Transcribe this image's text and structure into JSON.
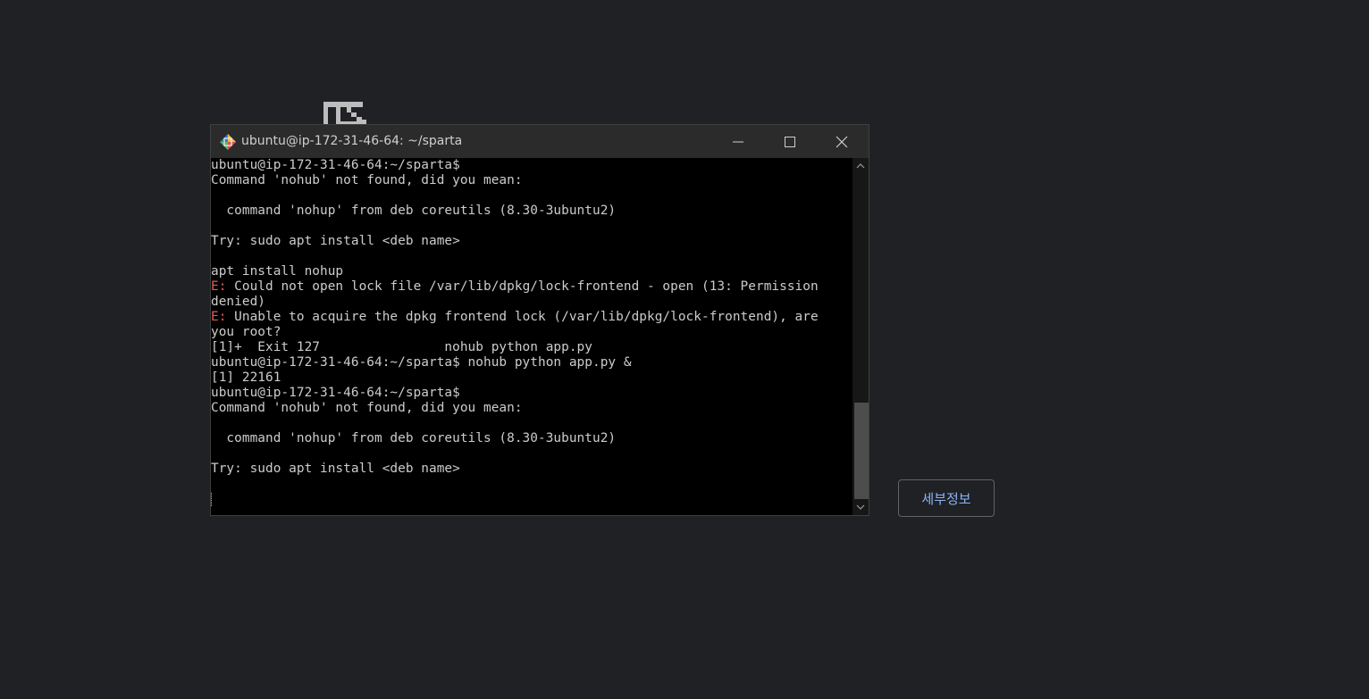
{
  "window": {
    "title": "ubuntu@ip-172-31-46-64: ~/sparta",
    "icon": "putty-icon"
  },
  "terminal": {
    "lines": [
      {
        "text": "ubuntu@ip-172-31-46-64:~/sparta$"
      },
      {
        "text": "Command 'nohub' not found, did you mean:"
      },
      {
        "text": ""
      },
      {
        "text": "  command 'nohup' from deb coreutils (8.30-3ubuntu2)"
      },
      {
        "text": ""
      },
      {
        "text": "Try: sudo apt install <deb name>"
      },
      {
        "text": ""
      },
      {
        "text": "apt install nohup"
      },
      {
        "prefix": "E: ",
        "text": "Could not open lock file /var/lib/dpkg/lock-frontend - open (13: Permission"
      },
      {
        "text": "denied)"
      },
      {
        "prefix": "E: ",
        "text": "Unable to acquire the dpkg frontend lock (/var/lib/dpkg/lock-frontend), are"
      },
      {
        "text": "you root?"
      },
      {
        "text": "[1]+  Exit 127                nohub python app.py"
      },
      {
        "text": "ubuntu@ip-172-31-46-64:~/sparta$ nohub python app.py &"
      },
      {
        "text": "[1] 22161"
      },
      {
        "text": "ubuntu@ip-172-31-46-64:~/sparta$"
      },
      {
        "text": "Command 'nohub' not found, did you mean:"
      },
      {
        "text": ""
      },
      {
        "text": "  command 'nohup' from deb coreutils (8.30-3ubuntu2)"
      },
      {
        "text": ""
      },
      {
        "text": "Try: sudo apt install <deb name>"
      },
      {
        "text": ""
      },
      {
        "text": ""
      }
    ]
  },
  "page": {
    "details_button_label": "세부정보"
  },
  "colors": {
    "page_background": "#202124",
    "terminal_background": "#000000",
    "terminal_text": "#cccccc",
    "error_prefix": "#e85a5a",
    "button_text": "#8ab4f8"
  }
}
